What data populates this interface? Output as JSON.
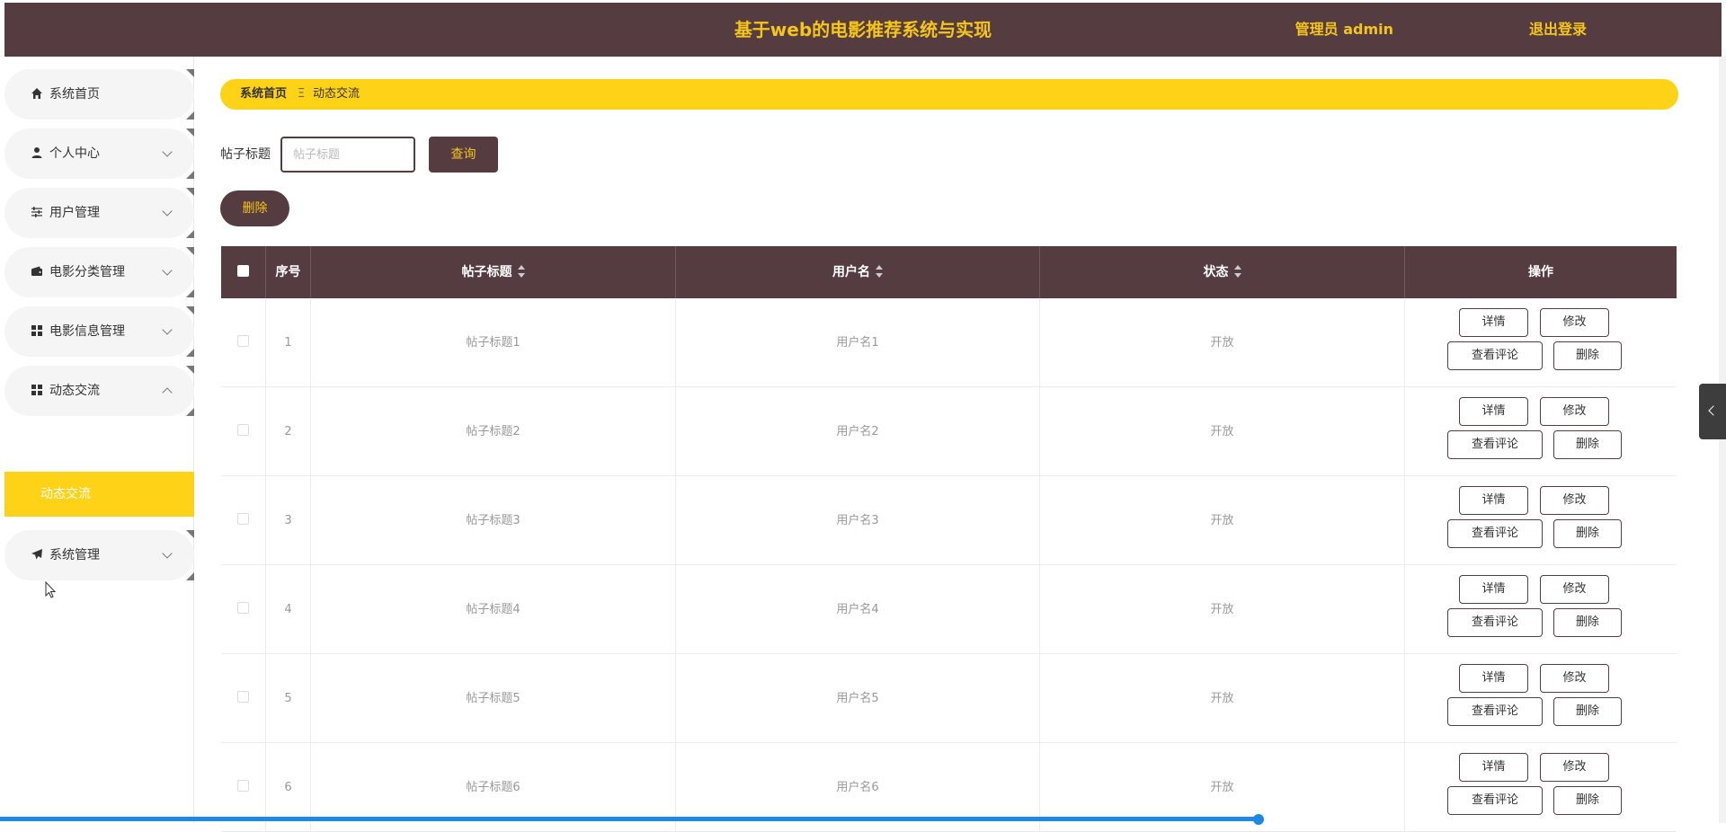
{
  "header": {
    "title": "基于web的电影推荐系统与实现",
    "admin": "管理员 admin",
    "logout": "退出登录"
  },
  "sidebar": {
    "items": [
      {
        "label": "系统首页",
        "icon": "home-icon"
      },
      {
        "label": "个人中心",
        "icon": "user-icon"
      },
      {
        "label": "用户管理",
        "icon": "sliders-icon"
      },
      {
        "label": "电影分类管理",
        "icon": "wallet-icon"
      },
      {
        "label": "电影信息管理",
        "icon": "grid-icon"
      },
      {
        "label": "动态交流",
        "icon": "grid-icon"
      },
      {
        "label": "系统管理",
        "icon": "send-icon"
      }
    ],
    "active_sub": "动态交流"
  },
  "breadcrumb": {
    "home": "系统首页",
    "separator": "Ξ",
    "current": "动态交流"
  },
  "search": {
    "label": "帖子标题",
    "placeholder": "帖子标题",
    "button": "查询"
  },
  "actions": {
    "delete": "删除"
  },
  "table": {
    "headers": [
      "序号",
      "帖子标题",
      "用户名",
      "状态",
      "操作"
    ],
    "rows": [
      {
        "index": "1",
        "title": "帖子标题1",
        "user": "用户名1",
        "status": "开放"
      },
      {
        "index": "2",
        "title": "帖子标题2",
        "user": "用户名2",
        "status": "开放"
      },
      {
        "index": "3",
        "title": "帖子标题3",
        "user": "用户名3",
        "status": "开放"
      },
      {
        "index": "4",
        "title": "帖子标题4",
        "user": "用户名4",
        "status": "开放"
      },
      {
        "index": "5",
        "title": "帖子标题5",
        "user": "用户名5",
        "status": "开放"
      },
      {
        "index": "6",
        "title": "帖子标题6",
        "user": "用户名6",
        "status": "开放"
      }
    ],
    "row_actions": {
      "detail": "详情",
      "edit": "修改",
      "comments": "查看评论",
      "delete": "删除"
    }
  },
  "colors": {
    "primary": "#543c41",
    "accent": "#fed216",
    "accent_text": "#f5c518"
  }
}
